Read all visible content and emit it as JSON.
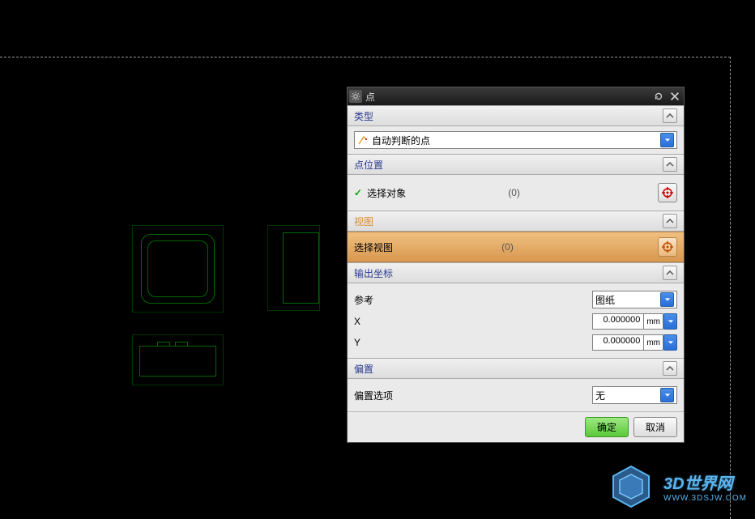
{
  "dialog": {
    "title": "点",
    "type": {
      "header": "类型",
      "selected": "自动判断的点"
    },
    "point_loc": {
      "header": "点位置",
      "select_label": "选择对象",
      "count": "(0)"
    },
    "view": {
      "header": "视图",
      "select_label": "选择视图",
      "count": "(0)"
    },
    "output": {
      "header": "输出坐标",
      "ref_label": "参考",
      "ref_value": "图纸",
      "x_label": "X",
      "x_value": "0.000000",
      "x_unit": "mm",
      "y_label": "Y",
      "y_value": "0.000000",
      "y_unit": "mm"
    },
    "offset": {
      "header": "偏置",
      "option_label": "偏置选项",
      "option_value": "无"
    },
    "ok": "确定",
    "cancel": "取消"
  },
  "watermark": {
    "title": "3D世界网",
    "url": "WWW.3DSJW.COM"
  }
}
